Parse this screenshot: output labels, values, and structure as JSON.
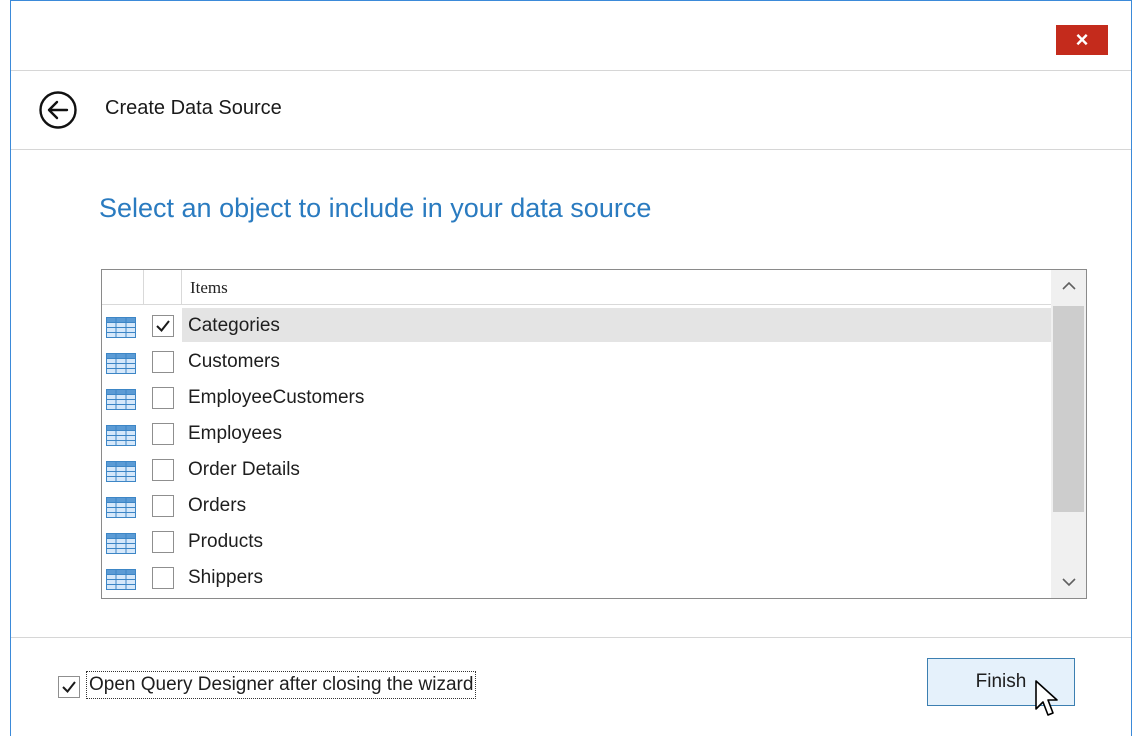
{
  "window": {
    "close_label": "×"
  },
  "header": {
    "title": "Create Data Source"
  },
  "main": {
    "heading": "Select an object to include in your data source"
  },
  "grid": {
    "column_header": "Items",
    "rows": [
      {
        "label": "Categories",
        "checked": true
      },
      {
        "label": "Customers",
        "checked": false
      },
      {
        "label": "EmployeeCustomers",
        "checked": false
      },
      {
        "label": "Employees",
        "checked": false
      },
      {
        "label": "Order Details",
        "checked": false
      },
      {
        "label": "Orders",
        "checked": false
      },
      {
        "label": "Products",
        "checked": false
      },
      {
        "label": "Shippers",
        "checked": false
      }
    ]
  },
  "footer": {
    "open_designer_label": "Open Query Designer after closing the wizard",
    "open_designer_checked": true,
    "finish_label": "Finish"
  },
  "colors": {
    "accent": "#2a7bc0",
    "close": "#c42b1c",
    "button_bg": "#e5f1fb"
  },
  "icons": [
    "close-icon",
    "back-arrow-icon",
    "table-icon",
    "checkmark-icon",
    "chevron-up-icon",
    "chevron-down-icon",
    "mouse-cursor-icon"
  ]
}
